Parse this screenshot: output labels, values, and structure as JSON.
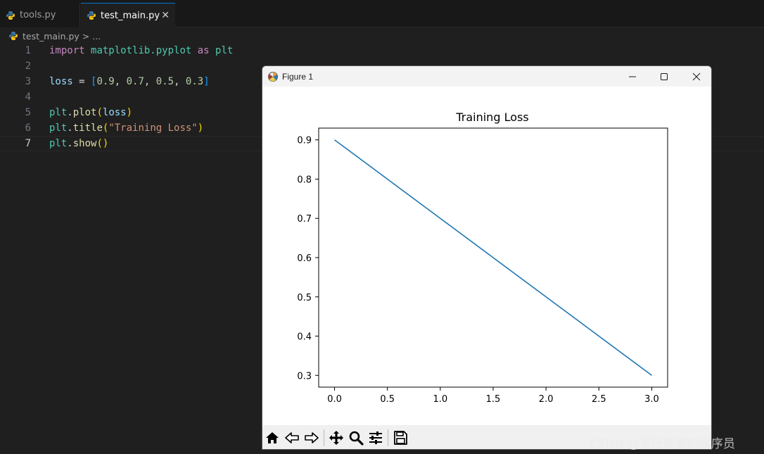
{
  "tabs": [
    {
      "label": "tools.py"
    },
    {
      "label": "test_main.py",
      "close": "✕"
    }
  ],
  "breadcrumb": {
    "file": "test_main.py",
    "separator": ">",
    "rest": "..."
  },
  "code": {
    "line_numbers": [
      "1",
      "2",
      "3",
      "4",
      "5",
      "6",
      "7"
    ],
    "line1": {
      "kw": "import",
      "module": "matplotlib.pyplot",
      "as": "as",
      "alias": "plt"
    },
    "line3": {
      "var": "loss",
      "eq": " = ",
      "open": "[",
      "v1": "0.9",
      "v2": "0.7",
      "v3": "0.5",
      "v4": "0.3",
      "comma": ", ",
      "close": "]"
    },
    "line5": {
      "obj": "plt",
      "dot": ".",
      "fn": "plot",
      "open": "(",
      "arg": "loss",
      "close": ")"
    },
    "line6": {
      "obj": "plt",
      "dot": ".",
      "fn": "title",
      "open": "(",
      "arg": "\"Training Loss\"",
      "close": ")"
    },
    "line7": {
      "obj": "plt",
      "dot": ".",
      "fn": "show",
      "open": "(",
      "close": ")"
    }
  },
  "figure_window": {
    "title": "Figure 1",
    "minimize": "minimize",
    "maximize": "maximize",
    "close": "close"
  },
  "toolbar_icons": [
    "home-icon",
    "back-icon",
    "forward-icon",
    "pan-icon",
    "zoom-icon",
    "configure-icon",
    "save-icon"
  ],
  "chart_data": {
    "type": "line",
    "title": "Training Loss",
    "x": [
      0,
      1,
      2,
      3
    ],
    "series": [
      {
        "values": [
          0.9,
          0.7,
          0.5,
          0.3
        ],
        "color": "#1f77b4"
      }
    ],
    "xlim": [
      -0.15,
      3.15
    ],
    "ylim": [
      0.27,
      0.93
    ],
    "xticks": [
      "0.0",
      "0.5",
      "1.0",
      "1.5",
      "2.0",
      "2.5",
      "3.0"
    ],
    "yticks": [
      "0.3",
      "0.4",
      "0.5",
      "0.6",
      "0.7",
      "0.8",
      "0.9"
    ],
    "xlabel": "",
    "ylabel": "",
    "grid": false
  },
  "watermark": "CSDN @爱玩亚索的程序员"
}
